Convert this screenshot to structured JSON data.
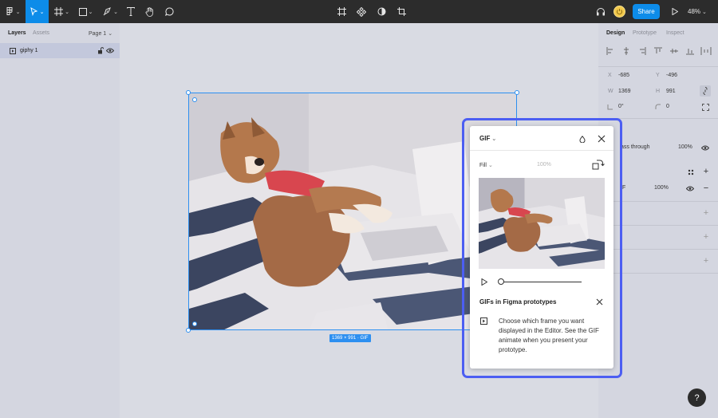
{
  "toolbar": {
    "share_label": "Share",
    "zoom": "48%",
    "tools": [
      "figma-menu-icon",
      "move-icon",
      "frame-icon",
      "rectangle-icon",
      "pen-icon",
      "text-icon",
      "hand-icon",
      "comment-icon"
    ],
    "center_tools": [
      "component-icon",
      "grid-components-icon",
      "contrast-icon",
      "crop-icon"
    ]
  },
  "left_panel": {
    "tab_layers": "Layers",
    "tab_assets": "Assets",
    "page": "Page 1",
    "layer_name": "giphy 1"
  },
  "canvas": {
    "dimension_label": "1369 × 991 · GIF"
  },
  "right_panel": {
    "tab_design": "Design",
    "tab_prototype": "Prototype",
    "tab_inspect": "Inspect",
    "x_label": "X",
    "x_value": "-685",
    "y_label": "Y",
    "y_value": "-496",
    "w_label": "W",
    "w_value": "1369",
    "h_label": "H",
    "h_value": "991",
    "rotation": "0°",
    "radius": "0",
    "blend": "ass through",
    "opacity": "100%",
    "fill_type": "IF",
    "fill_opacity": "100%"
  },
  "popup": {
    "title": "GIF",
    "fill_mode": "Fill",
    "fill_percent": "100%",
    "tip_title": "GIFs in Figma prototypes",
    "tip_body": "Choose which frame you want displayed in the Editor. See the GIF animate when you present your prototype."
  },
  "help_label": "?",
  "colors": {
    "accent": "#0d8ce9",
    "popup_outline": "#4c5ef2",
    "toolbar_bg": "#2c2c2c",
    "panel_bg": "#d4d6e0"
  }
}
